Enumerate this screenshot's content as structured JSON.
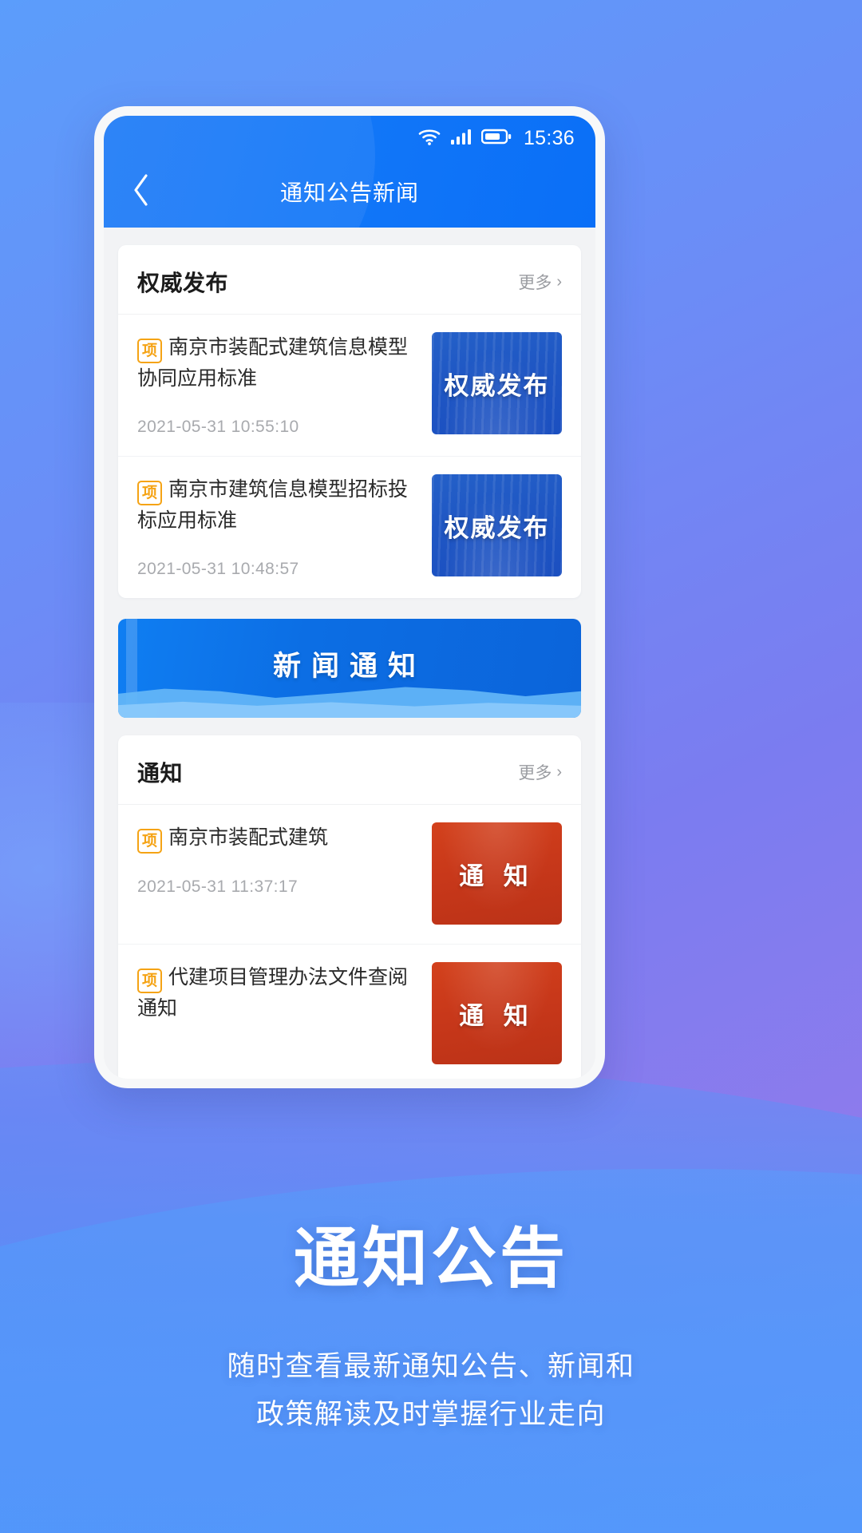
{
  "statusbar": {
    "time": "15:36",
    "icons": [
      "wifi-icon",
      "cellular-signal-icon",
      "battery-icon"
    ]
  },
  "navbar": {
    "back_icon": "chevron-left-icon",
    "title": "通知公告新闻"
  },
  "sections": [
    {
      "title": "权威发布",
      "more_label": "更多",
      "more_chevron": "›",
      "items": [
        {
          "tag": "项",
          "title": "南京市装配式建筑信息模型协同应用标准",
          "date": "2021-05-31 10:55:10",
          "thumb_text": "权威发布",
          "thumb_style": "blue"
        },
        {
          "tag": "项",
          "title": "南京市建筑信息模型招标投标应用标准",
          "date": "2021-05-31 10:48:57",
          "thumb_text": "权威发布",
          "thumb_style": "blue"
        }
      ]
    },
    {
      "title": "通知",
      "more_label": "更多",
      "more_chevron": "›",
      "items": [
        {
          "tag": "项",
          "title": "南京市装配式建筑",
          "date": "2021-05-31 11:37:17",
          "thumb_text": "通 知",
          "thumb_style": "red"
        },
        {
          "tag": "项",
          "title": "代建项目管理办法文件查阅通知",
          "date": "",
          "thumb_text": "通 知",
          "thumb_style": "red"
        }
      ]
    }
  ],
  "banner": {
    "text": "新闻通知"
  },
  "promo": {
    "title": "通知公告",
    "subtitle_line1": "随时查看最新通知公告、新闻和",
    "subtitle_line2": "政策解读及时掌握行业走向"
  }
}
